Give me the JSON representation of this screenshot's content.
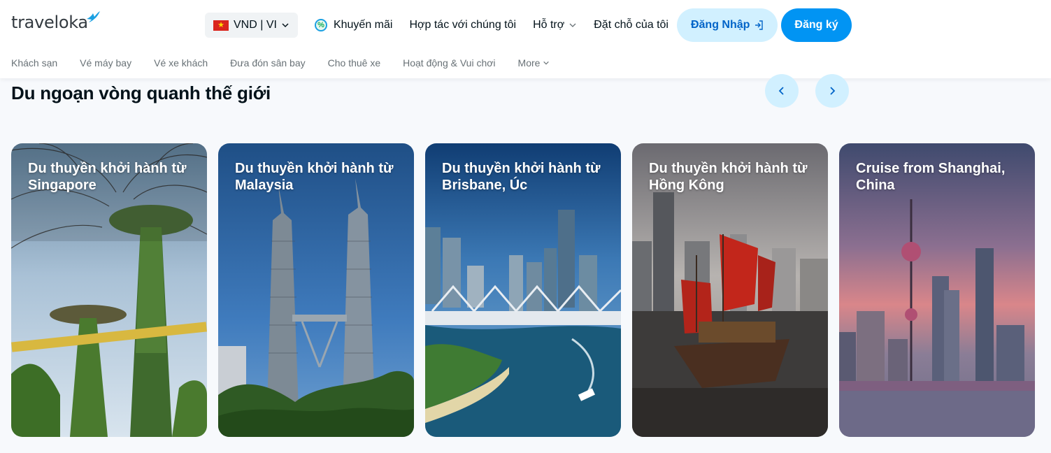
{
  "brand": {
    "logo_text": "traveloka"
  },
  "header": {
    "currency_label": "VND | VI",
    "flag_icon": "vietnam-flag-icon",
    "nav": {
      "promotions": "Khuyến mãi",
      "partner": "Hợp tác với chúng tôi",
      "support": "Hỗ trợ",
      "my_bookings": "Đặt chỗ của tôi"
    },
    "login_label": "Đăng Nhập",
    "register_label": "Đăng ký"
  },
  "sub_nav": {
    "items": [
      "Khách sạn",
      "Vé máy bay",
      "Vé xe khách",
      "Đưa đón sân bay",
      "Cho thuê xe",
      "Hoạt động & Vui chơi"
    ],
    "more_label": "More"
  },
  "section": {
    "title": "Du ngoạn vòng quanh thế giới",
    "prev_icon": "chevron-left-icon",
    "next_icon": "chevron-right-icon"
  },
  "cards": [
    {
      "title": "Du thuyền khởi hành từ Singapore"
    },
    {
      "title": "Du thuyền khởi hành từ Malaysia"
    },
    {
      "title": "Du thuyền khởi hành từ Brisbane, Úc"
    },
    {
      "title": "Du thuyền khởi hành từ Hồng Kông"
    },
    {
      "title": "Cruise from Shanghai, China"
    }
  ],
  "colors": {
    "primary": "#0194f3",
    "login_bg": "#d1f0ff",
    "login_text": "#0264c8",
    "text": "#03121a",
    "muted": "#687176"
  }
}
